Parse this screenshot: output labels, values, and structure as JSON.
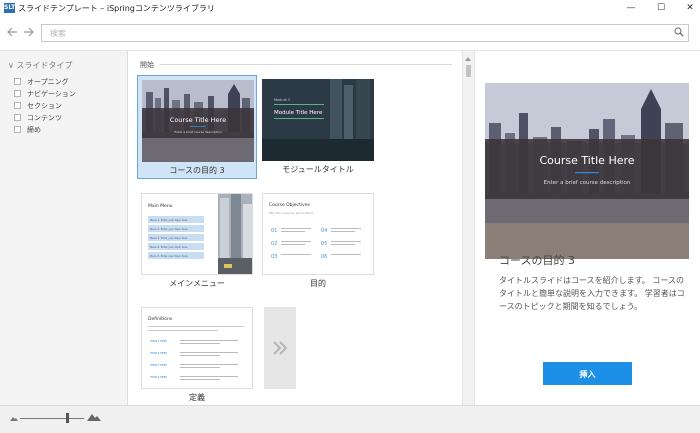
{
  "window": {
    "app_icon": "SLT",
    "title": "スライドテンプレート – iSpringコンテンツライブラリ",
    "controls": {
      "minimize": "—",
      "maximize": "☐",
      "close": "✕"
    }
  },
  "toolbar": {
    "back_icon": "arrow-left-icon",
    "forward_icon": "arrow-right-icon",
    "search_placeholder": "検索"
  },
  "sidebar": {
    "header": "∨ スライドタイプ",
    "filters": [
      {
        "label": "オープニング",
        "checked": false
      },
      {
        "label": "ナビゲーション",
        "checked": false
      },
      {
        "label": "セクション",
        "checked": false
      },
      {
        "label": "コンテンツ",
        "checked": false
      },
      {
        "label": "締め",
        "checked": false
      }
    ]
  },
  "gallery": {
    "section_label": "開始",
    "items": [
      {
        "label": "コースの目的 3",
        "selected": true,
        "title": "Course Title Here",
        "subtitle": "Enter a brief course description"
      },
      {
        "label": "モジュールタイトル",
        "selected": false,
        "module": "Module 1",
        "title": "Module Title Here"
      },
      {
        "label": "メインメニュー",
        "selected": false,
        "title": "Main Menu",
        "menu_items": [
          "Menu 1. Enter your topic here",
          "Menu 2. Enter your topic here",
          "Menu 3. Enter your topic here",
          "Menu 4. Enter your topic here",
          "Menu 5. Enter your topic here"
        ]
      },
      {
        "label": "目的",
        "selected": false,
        "title": "Course Objectives",
        "subtitle": "After this course you will be able to:",
        "numbers": [
          "01",
          "02",
          "03",
          "04",
          "05",
          "06"
        ]
      },
      {
        "label": "定義",
        "selected": false,
        "title": "Definitions",
        "terms": [
          "TERM 1 HERE",
          "TERM 2 HERE",
          "TERM 3 HERE",
          "TERM 4 HERE"
        ]
      }
    ],
    "more_icon": "chevron-double-right-icon"
  },
  "preview": {
    "slide_title": "Course Title Here",
    "slide_subtitle": "Enter a brief course description",
    "title": "コースの目的 3",
    "description": "タイトルスライドはコースを紹介します。 コースのタイトルと簡単な説明を入力できます。 学習者はコースのトピックと期間を知るでしょう。",
    "insert_button": "挿入"
  },
  "statusbar": {
    "zoom_out_icon": "small-mountain-icon",
    "zoom_in_icon": "large-mountain-icon",
    "zoom_level": 0.74
  },
  "colors": {
    "accent": "#1e8fe6",
    "selected_bg": "#cfe4f7",
    "selected_border": "#6fa6da",
    "dark_band": "#3a3438"
  }
}
